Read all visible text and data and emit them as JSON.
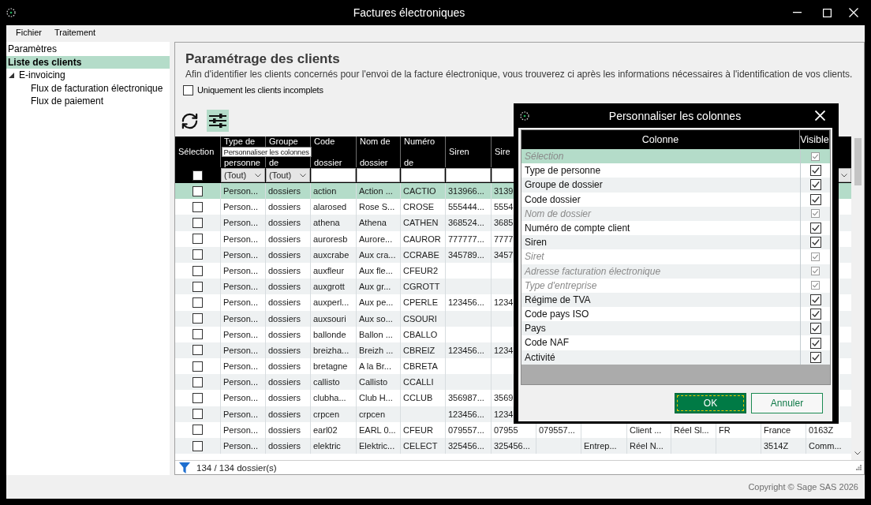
{
  "window": {
    "title": "Factures électroniques"
  },
  "menu": [
    "Fichier",
    "Traitement"
  ],
  "sidebar": {
    "items": [
      {
        "label": "Paramètres",
        "selected": false
      },
      {
        "label": "Liste des clients",
        "selected": true
      },
      {
        "label": "E-invoicing",
        "selected": false,
        "expanded": true,
        "children": [
          {
            "label": "Flux de facturation électronique",
            "selected": false
          },
          {
            "label": "Flux de paiement",
            "selected": false
          }
        ]
      }
    ]
  },
  "page": {
    "title": "Paramétrage des clients",
    "description": "Afin d'identifier les clients concernés pour l'envoi de la facture électronique, vous trouverez ci après les informations nécessaires à l'identification de vos clients.",
    "filter": {
      "label": "Uniquement les clients incomplets",
      "checked": false
    }
  },
  "toolbar": {
    "buttons": [
      {
        "kind": "refresh",
        "highlighted": false
      },
      {
        "kind": "columns",
        "highlighted": true,
        "tooltip": "Personnaliser les colonnes"
      }
    ]
  },
  "table": {
    "selection_column": {
      "label": "Sélection",
      "filter": {
        "kind": "checkbox",
        "checked": false
      }
    },
    "columns": [
      {
        "label": "Type de personne",
        "filter": {
          "kind": "dropdown",
          "value": "(Tout)"
        }
      },
      {
        "label": "Groupe de",
        "filter": {
          "kind": "dropdown",
          "value": "(Tout)"
        }
      },
      {
        "label": "Code dossier",
        "filter": {
          "kind": "text"
        }
      },
      {
        "label": "Nom de dossier",
        "filter": {
          "kind": "text"
        }
      },
      {
        "label": "Numéro de",
        "filter": {
          "kind": "text"
        }
      },
      {
        "label": "Siren",
        "filter": {
          "kind": "text"
        }
      },
      {
        "label": "Sire",
        "filter": {
          "kind": "text"
        }
      },
      {},
      {},
      {},
      {},
      {},
      {},
      {
        "filter": {
          "kind": "dropdown"
        }
      }
    ],
    "rows": [
      {
        "checked": false,
        "selected": true,
        "cells": [
          "Person...",
          "dossiers",
          "action",
          "Action ...",
          "CACTIO",
          "313966...",
          "3139"
        ]
      },
      {
        "checked": false,
        "selected": false,
        "cells": [
          "Person...",
          "dossiers",
          "alarosed",
          "Rose S...",
          "CROSE",
          "555444...",
          "5554"
        ]
      },
      {
        "checked": false,
        "selected": false,
        "cells": [
          "Person...",
          "dossiers",
          "athena",
          "Athena",
          "CATHEN",
          "368524...",
          "3685"
        ]
      },
      {
        "checked": false,
        "selected": false,
        "cells": [
          "Person...",
          "dossiers",
          "auroresb",
          "Aurore...",
          "CAUROR",
          "777777...",
          "7777"
        ]
      },
      {
        "checked": false,
        "selected": false,
        "cells": [
          "Person...",
          "dossiers",
          "auxcrabe",
          "Aux cra...",
          "CCRABE",
          "345789...",
          "3457"
        ]
      },
      {
        "checked": false,
        "selected": false,
        "cells": [
          "Person...",
          "dossiers",
          "auxfleur",
          "Aux fle...",
          "CFEUR2"
        ]
      },
      {
        "checked": false,
        "selected": false,
        "cells": [
          "Person...",
          "dossiers",
          "auxgrott",
          "Aux gr...",
          "CGROTT"
        ]
      },
      {
        "checked": false,
        "selected": false,
        "cells": [
          "Person...",
          "dossiers",
          "auxperl...",
          "Aux pe...",
          "CPERLE",
          "123456...",
          "1234"
        ]
      },
      {
        "checked": false,
        "selected": false,
        "cells": [
          "Person...",
          "dossiers",
          "auxsouri",
          "Aux so...",
          "CSOURI"
        ]
      },
      {
        "checked": false,
        "selected": false,
        "cells": [
          "Person...",
          "dossiers",
          "ballonde",
          "Ballon ...",
          "CBALLO"
        ]
      },
      {
        "checked": false,
        "selected": false,
        "cells": [
          "Person...",
          "dossiers",
          "breizha...",
          "Breizh ...",
          "CBREIZ",
          "123456...",
          "1234"
        ]
      },
      {
        "checked": false,
        "selected": false,
        "cells": [
          "Person...",
          "dossiers",
          "bretagne",
          "A la Br...",
          "CBRETA"
        ]
      },
      {
        "checked": false,
        "selected": false,
        "cells": [
          "Person...",
          "dossiers",
          "callisto",
          "Callisto",
          "CCALLI"
        ]
      },
      {
        "checked": false,
        "selected": false,
        "cells": [
          "Person...",
          "dossiers",
          "clubha...",
          "Club H...",
          "CCLUB",
          "356987...",
          "3569"
        ]
      },
      {
        "checked": false,
        "selected": false,
        "cells": [
          "Person...",
          "dossiers",
          "crpcen",
          "crpcen",
          null,
          "123456...",
          "1234"
        ]
      },
      {
        "checked": false,
        "selected": false,
        "cells": [
          "Person...",
          "dossiers",
          "earl02",
          "EARL 0...",
          "CFEUR",
          "079557...",
          "07955",
          "079557...",
          null,
          "Client ...",
          "Réel Sl...",
          "FR",
          "France",
          "0163Z"
        ]
      },
      {
        "checked": false,
        "selected": false,
        "cells": [
          "Person...",
          "dossiers",
          "elektric",
          "Elektric...",
          "CELECT",
          "325456...",
          "325456...",
          null,
          "Entrep...",
          "Réel N...",
          null,
          null,
          "3514Z",
          "Comm..."
        ]
      }
    ],
    "count": "134 / 134 dossier(s)"
  },
  "dialog": {
    "title": "Personnaliser les colonnes",
    "columns": [
      "Colonne",
      "Visible"
    ],
    "rows": [
      {
        "label": "Sélection",
        "checked": true,
        "disabled": true,
        "selected": true
      },
      {
        "label": "Type de personne",
        "checked": true,
        "disabled": false,
        "selected": false
      },
      {
        "label": "Groupe de dossier",
        "checked": true,
        "disabled": false,
        "selected": false
      },
      {
        "label": "Code dossier",
        "checked": true,
        "disabled": false,
        "selected": false
      },
      {
        "label": "Nom de dossier",
        "checked": true,
        "disabled": true,
        "selected": false
      },
      {
        "label": "Numéro de compte client",
        "checked": true,
        "disabled": false,
        "selected": false
      },
      {
        "label": "Siren",
        "checked": true,
        "disabled": false,
        "selected": false
      },
      {
        "label": "Siret",
        "checked": true,
        "disabled": true,
        "selected": false
      },
      {
        "label": "Adresse facturation électronique",
        "checked": true,
        "disabled": true,
        "selected": false
      },
      {
        "label": "Type d'entreprise",
        "checked": true,
        "disabled": true,
        "selected": false
      },
      {
        "label": "Régime de TVA",
        "checked": true,
        "disabled": false,
        "selected": false
      },
      {
        "label": "Code pays ISO",
        "checked": true,
        "disabled": false,
        "selected": false
      },
      {
        "label": "Pays",
        "checked": true,
        "disabled": false,
        "selected": false
      },
      {
        "label": "Code NAF",
        "checked": true,
        "disabled": false,
        "selected": false
      },
      {
        "label": "Activité",
        "checked": true,
        "disabled": false,
        "selected": false
      }
    ],
    "buttons": [
      {
        "label": "OK",
        "kind": "primary",
        "focused": true
      },
      {
        "label": "Annuler",
        "kind": "secondary",
        "focused": false
      }
    ]
  },
  "status_bar": {
    "copyright": "Copyright © Sage SAS 2026"
  }
}
